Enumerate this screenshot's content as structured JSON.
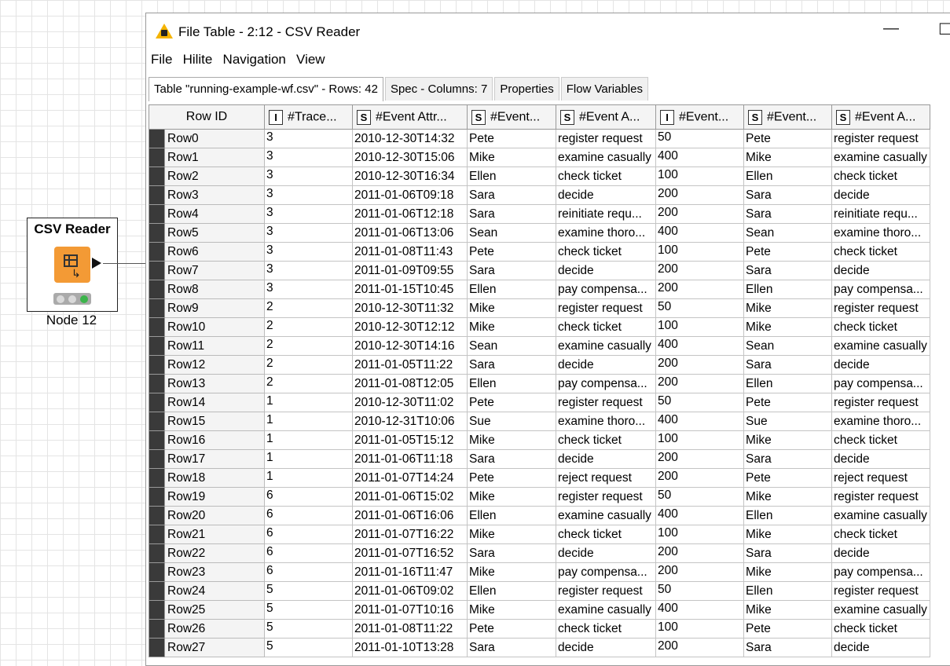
{
  "node": {
    "title": "CSV Reader",
    "label": "Node 12",
    "status_colors": [
      "#d9d9d9",
      "#d9d9d9",
      "#3cb44b"
    ]
  },
  "window": {
    "title": "File Table - 2:12 - CSV Reader",
    "minimize_glyph": "—",
    "maximize_glyph": "☐"
  },
  "menu": [
    "File",
    "Hilite",
    "Navigation",
    "View"
  ],
  "tabs": [
    "Table \"running-example-wf.csv\" - Rows: 42",
    "Spec - Columns: 7",
    "Properties",
    "Flow Variables"
  ],
  "columns": [
    {
      "type": "",
      "label": "Row ID"
    },
    {
      "type": "I",
      "label": "#Trace..."
    },
    {
      "type": "S",
      "label": "#Event Attr..."
    },
    {
      "type": "S",
      "label": "#Event..."
    },
    {
      "type": "S",
      "label": "#Event A..."
    },
    {
      "type": "I",
      "label": "#Event..."
    },
    {
      "type": "S",
      "label": "#Event..."
    },
    {
      "type": "S",
      "label": "#Event A..."
    }
  ],
  "rows": [
    [
      "Row0",
      "3",
      "2010-12-30T14:32",
      "Pete",
      "register request",
      "50",
      "Pete",
      "register request"
    ],
    [
      "Row1",
      "3",
      "2010-12-30T15:06",
      "Mike",
      "examine casually",
      "400",
      "Mike",
      "examine casually"
    ],
    [
      "Row2",
      "3",
      "2010-12-30T16:34",
      "Ellen",
      "check ticket",
      "100",
      "Ellen",
      "check ticket"
    ],
    [
      "Row3",
      "3",
      "2011-01-06T09:18",
      "Sara",
      "decide",
      "200",
      "Sara",
      "decide"
    ],
    [
      "Row4",
      "3",
      "2011-01-06T12:18",
      "Sara",
      "reinitiate requ...",
      "200",
      "Sara",
      "reinitiate requ..."
    ],
    [
      "Row5",
      "3",
      "2011-01-06T13:06",
      "Sean",
      "examine thoro...",
      "400",
      "Sean",
      "examine thoro..."
    ],
    [
      "Row6",
      "3",
      "2011-01-08T11:43",
      "Pete",
      "check ticket",
      "100",
      "Pete",
      "check ticket"
    ],
    [
      "Row7",
      "3",
      "2011-01-09T09:55",
      "Sara",
      "decide",
      "200",
      "Sara",
      "decide"
    ],
    [
      "Row8",
      "3",
      "2011-01-15T10:45",
      "Ellen",
      "pay compensa...",
      "200",
      "Ellen",
      "pay compensa..."
    ],
    [
      "Row9",
      "2",
      "2010-12-30T11:32",
      "Mike",
      "register request",
      "50",
      "Mike",
      "register request"
    ],
    [
      "Row10",
      "2",
      "2010-12-30T12:12",
      "Mike",
      "check ticket",
      "100",
      "Mike",
      "check ticket"
    ],
    [
      "Row11",
      "2",
      "2010-12-30T14:16",
      "Sean",
      "examine casually",
      "400",
      "Sean",
      "examine casually"
    ],
    [
      "Row12",
      "2",
      "2011-01-05T11:22",
      "Sara",
      "decide",
      "200",
      "Sara",
      "decide"
    ],
    [
      "Row13",
      "2",
      "2011-01-08T12:05",
      "Ellen",
      "pay compensa...",
      "200",
      "Ellen",
      "pay compensa..."
    ],
    [
      "Row14",
      "1",
      "2010-12-30T11:02",
      "Pete",
      "register request",
      "50",
      "Pete",
      "register request"
    ],
    [
      "Row15",
      "1",
      "2010-12-31T10:06",
      "Sue",
      "examine thoro...",
      "400",
      "Sue",
      "examine thoro..."
    ],
    [
      "Row16",
      "1",
      "2011-01-05T15:12",
      "Mike",
      "check ticket",
      "100",
      "Mike",
      "check ticket"
    ],
    [
      "Row17",
      "1",
      "2011-01-06T11:18",
      "Sara",
      "decide",
      "200",
      "Sara",
      "decide"
    ],
    [
      "Row18",
      "1",
      "2011-01-07T14:24",
      "Pete",
      "reject request",
      "200",
      "Pete",
      "reject request"
    ],
    [
      "Row19",
      "6",
      "2011-01-06T15:02",
      "Mike",
      "register request",
      "50",
      "Mike",
      "register request"
    ],
    [
      "Row20",
      "6",
      "2011-01-06T16:06",
      "Ellen",
      "examine casually",
      "400",
      "Ellen",
      "examine casually"
    ],
    [
      "Row21",
      "6",
      "2011-01-07T16:22",
      "Mike",
      "check ticket",
      "100",
      "Mike",
      "check ticket"
    ],
    [
      "Row22",
      "6",
      "2011-01-07T16:52",
      "Sara",
      "decide",
      "200",
      "Sara",
      "decide"
    ],
    [
      "Row23",
      "6",
      "2011-01-16T11:47",
      "Mike",
      "pay compensa...",
      "200",
      "Mike",
      "pay compensa..."
    ],
    [
      "Row24",
      "5",
      "2011-01-06T09:02",
      "Ellen",
      "register request",
      "50",
      "Ellen",
      "register request"
    ],
    [
      "Row25",
      "5",
      "2011-01-07T10:16",
      "Mike",
      "examine casually",
      "400",
      "Mike",
      "examine casually"
    ],
    [
      "Row26",
      "5",
      "2011-01-08T11:22",
      "Pete",
      "check ticket",
      "100",
      "Pete",
      "check ticket"
    ],
    [
      "Row27",
      "5",
      "2011-01-10T13:28",
      "Sara",
      "decide",
      "200",
      "Sara",
      "decide"
    ]
  ]
}
